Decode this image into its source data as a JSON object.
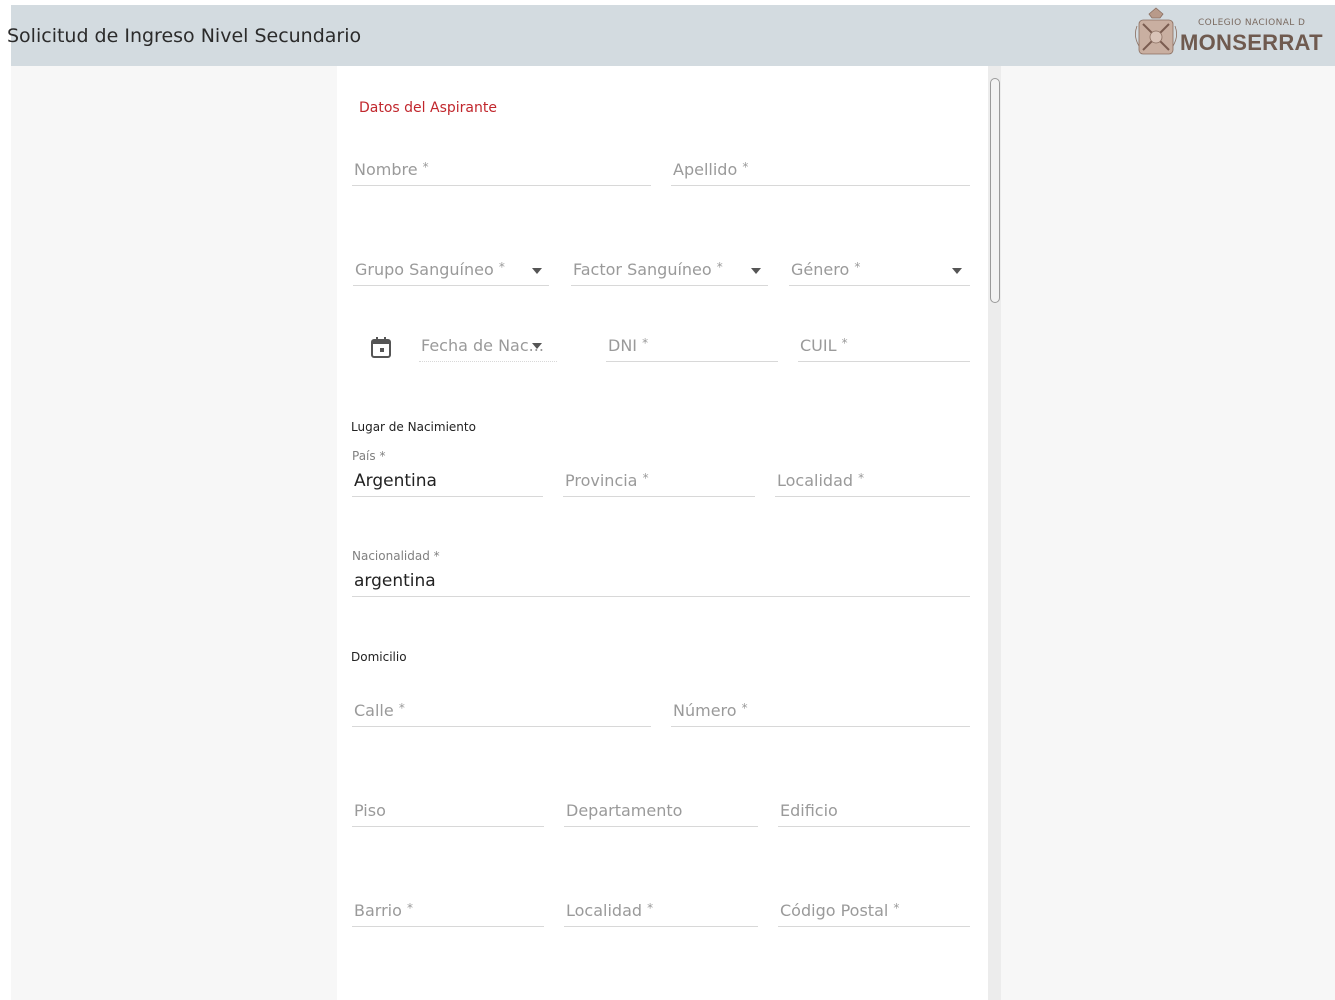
{
  "header": {
    "title": "Solicitud de Ingreso Nivel Secundario",
    "logo_small": "COLEGIO NACIONAL D",
    "logo_big": "MONSERRAT"
  },
  "form": {
    "section_title": "Datos del Aspirante",
    "fields": {
      "nombre": {
        "label": "Nombre",
        "required": "*"
      },
      "apellido": {
        "label": "Apellido",
        "required": "*"
      },
      "grupo_sanguineo": {
        "label": "Grupo Sanguíneo",
        "required": "*"
      },
      "factor_sanguineo": {
        "label": "Factor Sanguíneo",
        "required": "*"
      },
      "genero": {
        "label": "Género",
        "required": "*"
      },
      "fecha_nacimiento": {
        "label": "Fecha de Nac..."
      },
      "dni": {
        "label": "DNI",
        "required": "*"
      },
      "cuil": {
        "label": "CUIL",
        "required": "*"
      }
    },
    "lugar_nacimiento": {
      "heading": "Lugar de Nacimiento",
      "pais": {
        "label": "País *",
        "value": "Argentina"
      },
      "provincia": {
        "label": "Provincia",
        "required": "*"
      },
      "localidad": {
        "label": "Localidad",
        "required": "*"
      }
    },
    "nacionalidad": {
      "label": "Nacionalidad *",
      "value": "argentina"
    },
    "domicilio": {
      "heading": "Domicilio",
      "calle": {
        "label": "Calle",
        "required": "*"
      },
      "numero": {
        "label": "Número",
        "required": "*"
      },
      "piso": {
        "label": "Piso"
      },
      "departamento": {
        "label": "Departamento"
      },
      "edificio": {
        "label": "Edificio"
      },
      "barrio": {
        "label": "Barrio",
        "required": "*"
      },
      "localidad": {
        "label": "Localidad",
        "required": "*"
      },
      "codigo_postal": {
        "label": "Código Postal",
        "required": "*"
      }
    }
  },
  "colors": {
    "header_bg": "#d3dbe0",
    "accent": "#c1272d",
    "logo": "#6f5a4f"
  }
}
